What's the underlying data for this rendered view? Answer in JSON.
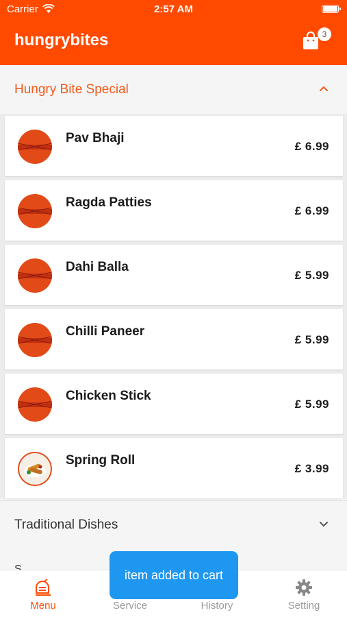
{
  "status": {
    "carrier": "Carrier",
    "time": "2:57 AM"
  },
  "header": {
    "title": "hungrybites",
    "cart_count": "3"
  },
  "colors": {
    "brand": "#ff4a00",
    "section_active": "#f35a1c",
    "toast": "#1e97f1"
  },
  "sections": [
    {
      "title": "Hungry Bite Special",
      "state": "expanded",
      "items": [
        {
          "name": "Pav Bhaji",
          "price": "£ 6.99"
        },
        {
          "name": "Ragda Patties",
          "price": "£ 6.99"
        },
        {
          "name": "Dahi Balla",
          "price": "£ 5.99"
        },
        {
          "name": "Chilli Paneer",
          "price": "£ 5.99"
        },
        {
          "name": "Chicken Stick",
          "price": "£ 5.99"
        },
        {
          "name": "Spring Roll",
          "price": "£ 3.99"
        }
      ]
    },
    {
      "title": "Traditional Dishes",
      "state": "collapsed"
    }
  ],
  "partial_next": "S",
  "tabs": [
    {
      "label": "Menu",
      "icon": "menu-food-icon",
      "active": true
    },
    {
      "label": "Service",
      "icon": "service-icon"
    },
    {
      "label": "History",
      "icon": "history-icon"
    },
    {
      "label": "Setting",
      "icon": "gear-icon"
    }
  ],
  "toast": {
    "text": "item added to cart"
  }
}
